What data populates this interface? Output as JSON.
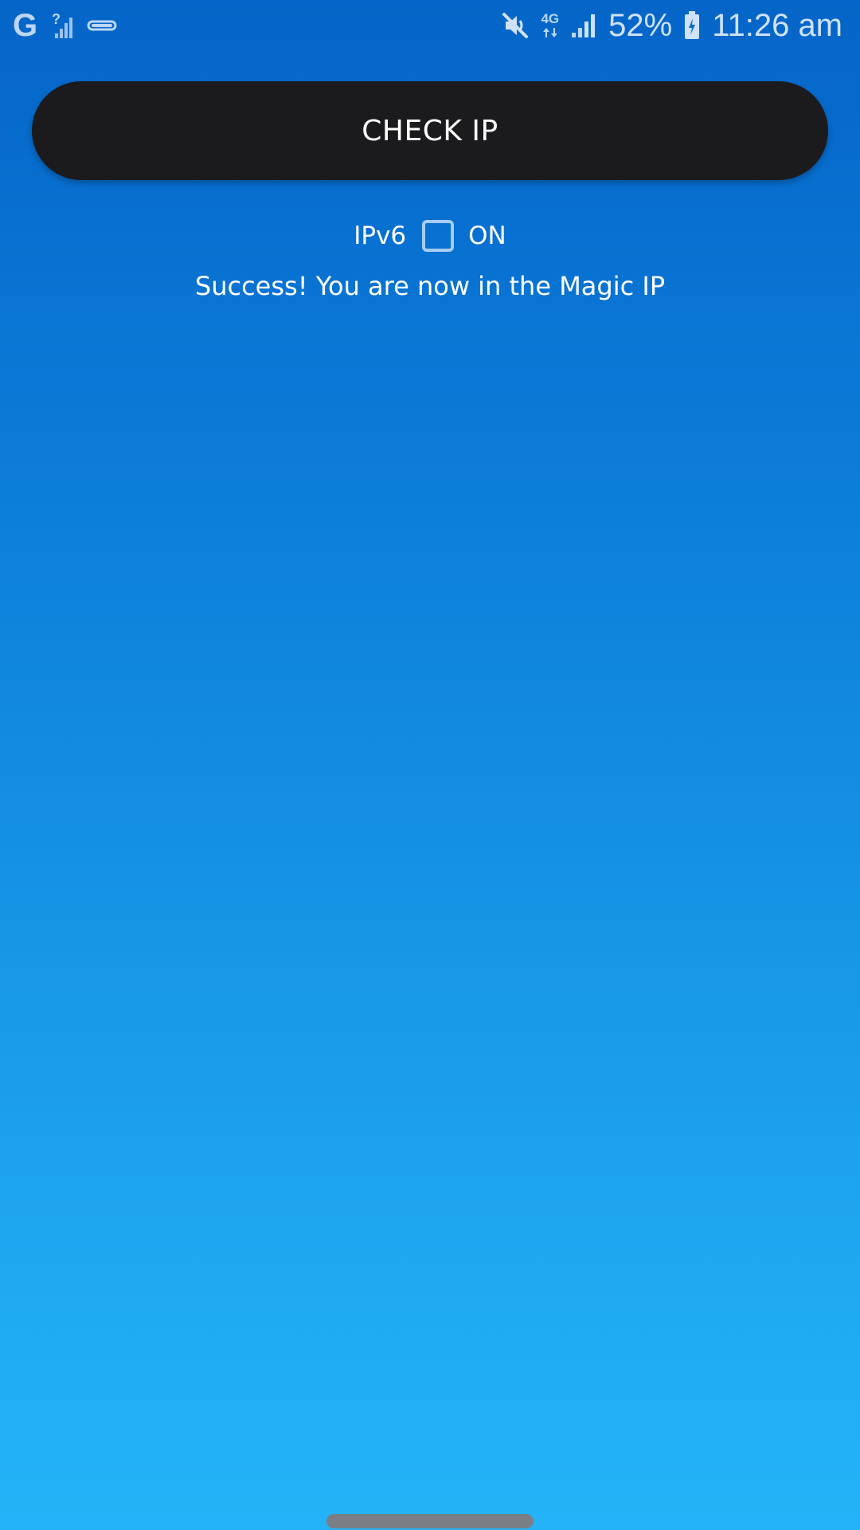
{
  "status_bar": {
    "left_icons": [
      "google-icon",
      "signal-unknown-icon",
      "cast-icon"
    ],
    "google_glyph": "G",
    "right_icons": [
      "mute-icon",
      "network-4g-icon",
      "signal-icon",
      "battery-icon"
    ],
    "network_type": "4G",
    "battery_percent": "52%",
    "time": "11:26 am"
  },
  "main": {
    "check_ip_label": "CHECK IP",
    "ipv6_label": "IPv6",
    "ipv6_checked": false,
    "on_label": "ON",
    "status_message": "Success! You are now in the Magic IP"
  },
  "colors": {
    "background_top": "#0565c8",
    "background_bottom": "#24b3f8",
    "button_bg": "#1b1b1e",
    "checkbox_border": "#a6cdf5"
  }
}
